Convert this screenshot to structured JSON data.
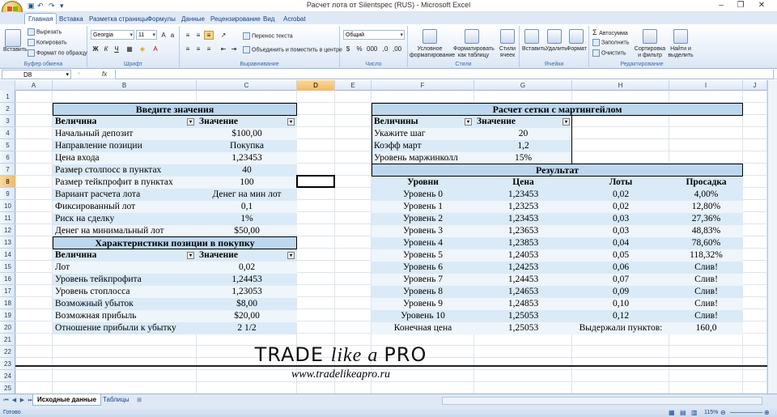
{
  "window": {
    "title": "Расчет лота от Silentspec (RUS) - Microsoft Excel",
    "minimize_icon": "minimize-icon",
    "restore_icon": "restore-icon",
    "close_icon": "close-icon"
  },
  "ribbon_tabs": [
    "Главная",
    "Вставка",
    "Разметка страницы",
    "Формулы",
    "Данные",
    "Рецензирование",
    "Вид",
    "Acrobat"
  ],
  "ribbon": {
    "clipboard": {
      "paste": "Вставить",
      "cut": "Вырезать",
      "copy": "Копировать",
      "format_painter": "Формат по образцу",
      "label": "Буфер обмена"
    },
    "font": {
      "name": "Georgia",
      "size": "11",
      "label": "Шрифт",
      "bold": "Ж",
      "italic": "К",
      "underline": "Ч"
    },
    "alignment": {
      "wrap": "Перенос текста",
      "merge": "Объединить и поместить в центре",
      "label": "Выравнивание"
    },
    "number": {
      "format": "Общий",
      "label": "Число"
    },
    "styles": {
      "conditional": "Условное форматирование",
      "as_table": "Форматировать как таблицу",
      "cell_styles": "Стили ячеек",
      "label": "Стили"
    },
    "cells": {
      "insert": "Вставить",
      "delete": "Удалить",
      "format": "Формат",
      "label": "Ячейки"
    },
    "editing": {
      "autosum": "Автосумма",
      "fill": "Заполнить",
      "clear": "Очистить",
      "sort": "Сортировка и фильтр",
      "find": "Найти и выделить",
      "label": "Редактирование"
    }
  },
  "formula_bar": {
    "name_box": "D8",
    "fx": "fx",
    "value": ""
  },
  "columns": [
    "A",
    "B",
    "C",
    "D",
    "E",
    "F",
    "G",
    "H",
    "I",
    "J"
  ],
  "rows": [
    "1",
    "2",
    "3",
    "4",
    "5",
    "6",
    "7",
    "8",
    "9",
    "10",
    "11",
    "12",
    "13",
    "14",
    "15",
    "16",
    "17",
    "18",
    "19",
    "20",
    "21",
    "22",
    "23",
    "24",
    "25"
  ],
  "selected": {
    "column": "D",
    "row": "8"
  },
  "input_table": {
    "title": "Введите значения",
    "col1": "Величина",
    "col2": "Значение",
    "rows": [
      [
        "Начальный депозит",
        "$100,00"
      ],
      [
        "Направление позиции",
        "Покупка"
      ],
      [
        "Цена входа",
        "1,23453"
      ],
      [
        "Размер столпосс в пунктах",
        "40"
      ],
      [
        "Размер тейкпрофит в пунктах",
        "100"
      ],
      [
        "Вариант расчета лота",
        "Денег на мин лот"
      ],
      [
        "Фиксированный лот",
        "0,1"
      ],
      [
        "Риск на сделку",
        "1%"
      ],
      [
        "Денег на минимальный лот",
        "$50,00"
      ]
    ]
  },
  "position_table": {
    "title": "Характеристики позиции в покупку",
    "col1": "Величина",
    "col2": "Значение",
    "rows": [
      [
        "Лот",
        "0,02"
      ],
      [
        "Уровень тейкпрофита",
        "1,24453"
      ],
      [
        "Уровень стоплосса",
        "1,23053"
      ],
      [
        "Возможный убыток",
        "$8,00"
      ],
      [
        "Возможная прибыль",
        "$20,00"
      ],
      [
        "Отношение прибыли к убытку",
        "2 1/2"
      ]
    ]
  },
  "grid_table": {
    "title": "Расчет сетки с мартингейлом",
    "col1": "Величины",
    "col2": "Значение",
    "rows": [
      [
        "Укажите шаг",
        "20"
      ],
      [
        "Коэфф март",
        "1,2"
      ],
      [
        "Уровень маржинколл",
        "15%"
      ]
    ]
  },
  "result_table": {
    "title": "Результат",
    "headers": [
      "Уровни",
      "Цена",
      "Лоты",
      "Просадка"
    ],
    "rows": [
      [
        "Уровень 0",
        "1,23453",
        "0,02",
        "4,00%"
      ],
      [
        "Уровень 1",
        "1,23253",
        "0,02",
        "12,80%"
      ],
      [
        "Уровень 2",
        "1,23453",
        "0,03",
        "27,36%"
      ],
      [
        "Уровень 3",
        "1,23653",
        "0,03",
        "48,83%"
      ],
      [
        "Уровень 4",
        "1,23853",
        "0,04",
        "78,60%"
      ],
      [
        "Уровень 5",
        "1,24053",
        "0,05",
        "118,32%"
      ],
      [
        "Уровень 6",
        "1,24253",
        "0,06",
        "Слив!"
      ],
      [
        "Уровень 7",
        "1,24453",
        "0,07",
        "Слив!"
      ],
      [
        "Уровень 8",
        "1,24653",
        "0,09",
        "Слив!"
      ],
      [
        "Уровень 9",
        "1,24853",
        "0,10",
        "Слив!"
      ],
      [
        "Уровень 10",
        "1,25053",
        "0,12",
        "Слив!"
      ]
    ],
    "final": [
      "Конечная цена",
      "1,25053",
      "Выдержали пунктов:",
      "160,0"
    ]
  },
  "brand": {
    "line1a": "TRADE ",
    "line1b": "like a ",
    "line1c": "PRO",
    "url": "www.tradelikeapro.ru"
  },
  "sheet_tabs": [
    "Исходные данные",
    "Таблицы"
  ],
  "status": {
    "ready": "Готово",
    "zoom": "115%"
  }
}
